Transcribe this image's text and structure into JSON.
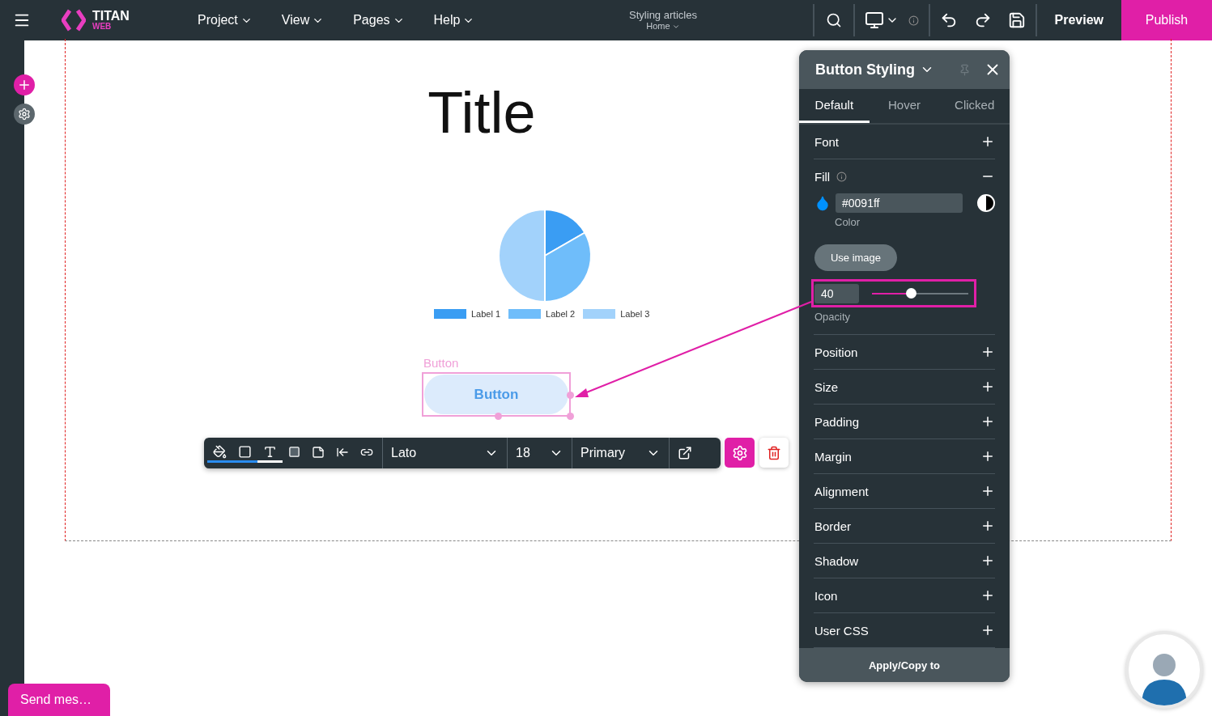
{
  "topbar": {
    "logo": {
      "name": "TITAN",
      "sub": "WEB"
    },
    "menus": [
      {
        "label": "Project"
      },
      {
        "label": "View"
      },
      {
        "label": "Pages"
      },
      {
        "label": "Help"
      }
    ],
    "document": {
      "title": "Styling articles",
      "page": "Home"
    },
    "preview": "Preview",
    "publish": "Publish"
  },
  "canvas": {
    "title": "Title",
    "legend": [
      {
        "label": "Label 1",
        "color": "#3a9df3"
      },
      {
        "label": "Label 2",
        "color": "#6fbdfa"
      },
      {
        "label": "Label 3",
        "color": "#a2d2fb"
      }
    ],
    "button": {
      "caption": "Button",
      "label": "Button",
      "selected": true
    }
  },
  "element_toolbar": {
    "font": "Lato",
    "size": "18",
    "style": "Primary"
  },
  "panel": {
    "title": "Button Styling",
    "tabs": [
      {
        "label": "Default",
        "selected": true
      },
      {
        "label": "Hover",
        "selected": false
      },
      {
        "label": "Clicked",
        "selected": false
      }
    ],
    "sections": [
      {
        "label": "Font",
        "expanded": false
      },
      {
        "label": "Fill",
        "expanded": true,
        "fill": {
          "color_value": "#0091ff",
          "color_label": "Color",
          "use_image": "Use image",
          "opacity": {
            "reading": "40",
            "level": 0.4,
            "label": "Opacity",
            "highlighted": true
          }
        }
      },
      {
        "label": "Position",
        "expanded": false
      },
      {
        "label": "Size",
        "expanded": false
      },
      {
        "label": "Padding",
        "expanded": false
      },
      {
        "label": "Margin",
        "expanded": false
      },
      {
        "label": "Alignment",
        "expanded": false
      },
      {
        "label": "Border",
        "expanded": false
      },
      {
        "label": "Shadow",
        "expanded": false
      },
      {
        "label": "Icon",
        "expanded": false
      },
      {
        "label": "User CSS",
        "expanded": false
      }
    ],
    "apply": "Apply/Copy to"
  },
  "chat": {
    "label": "Send mes…"
  }
}
